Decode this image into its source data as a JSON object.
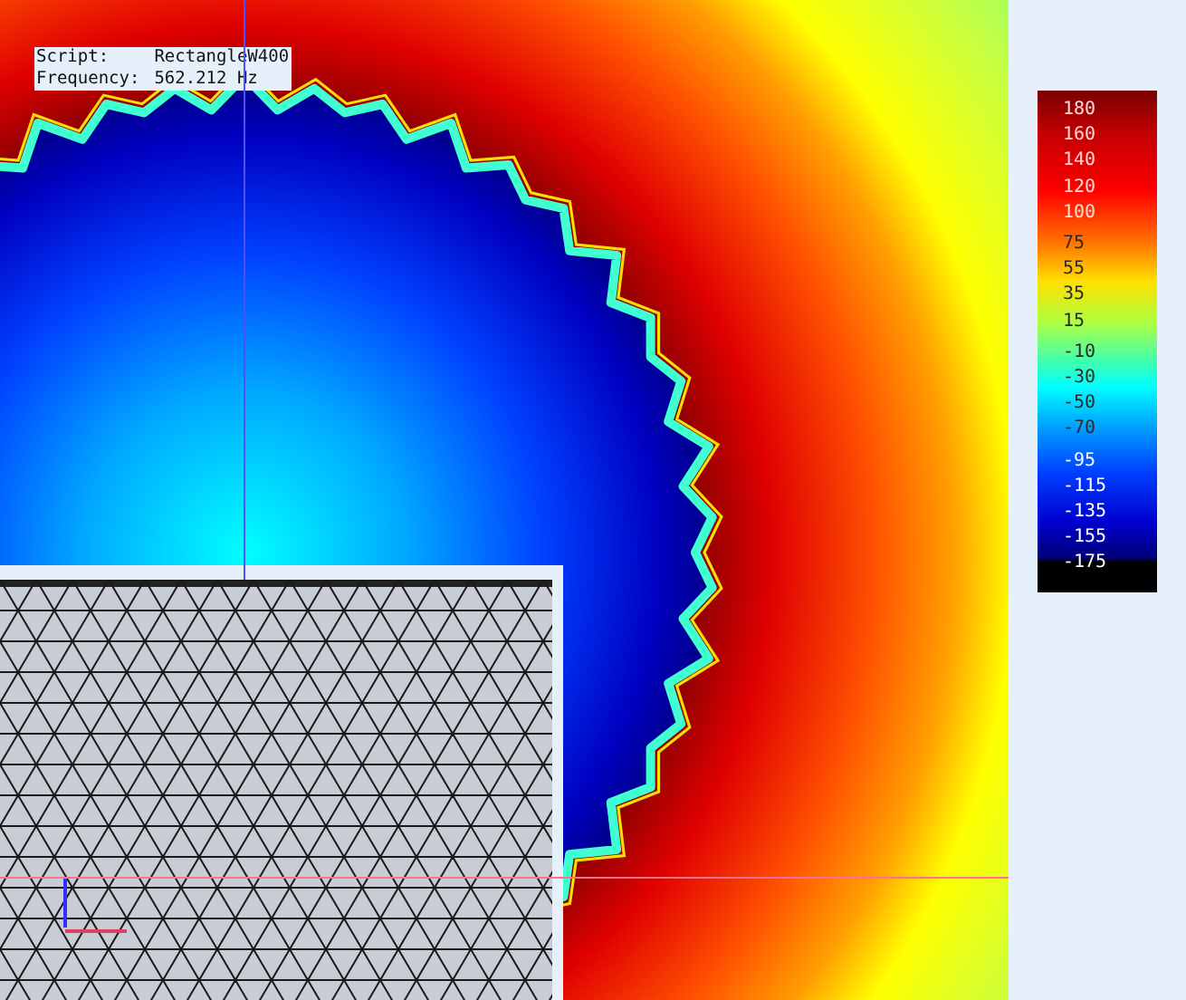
{
  "info": [
    {
      "label": "Script:",
      "value": "RectangleW400"
    },
    {
      "label": "Frequency:",
      "value": "562.212 Hz"
    }
  ],
  "colorbar": {
    "labels": [
      "180",
      "160",
      "140",
      "120",
      "100",
      "75",
      "55",
      "35",
      "15",
      "-10",
      "-30",
      "-50",
      "-70",
      "-95",
      "-115",
      "-135",
      "-155",
      "-175"
    ]
  }
}
